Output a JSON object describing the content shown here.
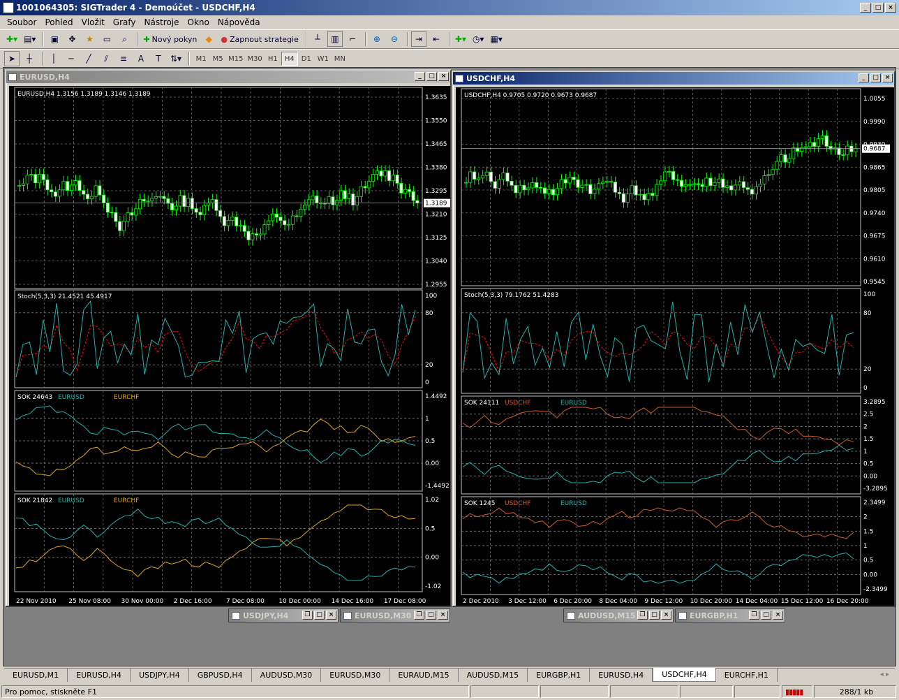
{
  "app": {
    "title": "1001064305: SIGTrader 4 - Demoúčet - USDCHF,H4"
  },
  "menu": [
    "Soubor",
    "Pohled",
    "Vložit",
    "Grafy",
    "Nástroje",
    "Okno",
    "Nápověda"
  ],
  "toolbar1": {
    "new_order": "Nový pokyn",
    "strategy": "Zapnout strategie"
  },
  "timeframes": [
    "M1",
    "M5",
    "M15",
    "M30",
    "H1",
    "H4",
    "D1",
    "W1",
    "MN"
  ],
  "active_timeframe": "H4",
  "eurusd": {
    "title": "EURUSD,H4",
    "ohlc_label": "EURUSD,H4  1.3156 1.3189 1.3146 1.3189",
    "price_ticks": [
      "1.3635",
      "1.3550",
      "1.3465",
      "1.3380",
      "1.3295",
      "1.3210",
      "1.3125",
      "1.3040",
      "1.2955"
    ],
    "current_price": "1.3189",
    "stoch_label": "Stoch(5,3,3) 21.4521 45.4917",
    "stoch_ticks": [
      "100",
      "80",
      "20",
      "0"
    ],
    "sok1": {
      "label": "SOK 24643",
      "leg1": "EURUSD",
      "leg2": "EURCHF",
      "ticks": [
        "1.4492",
        "1",
        "0.5",
        "0.00",
        "-1.4492"
      ]
    },
    "sok2": {
      "label": "SOK 21842",
      "leg1": "EURUSD",
      "leg2": "EURCHF",
      "ticks": [
        "1.02",
        "0.5",
        "0.00",
        "-1.02"
      ]
    },
    "dates": [
      "22 Nov 2010",
      "25 Nov 08:00",
      "30 Nov 00:00",
      "2 Dec 16:00",
      "7 Dec 08:00",
      "10 Dec 00:00",
      "14 Dec 16:00",
      "17 Dec 08:00"
    ]
  },
  "usdchf": {
    "title": "USDCHF,H4",
    "ohlc_label": "USDCHF,H4  0.9705 0.9720 0.9673 0.9687",
    "price_ticks": [
      "1.0055",
      "0.9990",
      "0.9930",
      "0.9865",
      "0.9805",
      "0.9740",
      "0.9675",
      "0.9610",
      "0.9545"
    ],
    "current_price": "0.9687",
    "stoch_label": "Stoch(5,3,3) 79.1762 51.4283",
    "stoch_ticks": [
      "100",
      "80",
      "20",
      "0"
    ],
    "sok1": {
      "label": "SOK 24111",
      "leg1": "USDCHF",
      "leg2": "EURUSD",
      "ticks": [
        "3.2895",
        "2.5",
        "2",
        "1.5",
        "1",
        "0.5",
        "0.00",
        "-3.2895"
      ]
    },
    "sok2": {
      "label": "SOK 1245",
      "leg1": "USDCHF",
      "leg2": "EURUSD",
      "ticks": [
        "2.3499",
        "2",
        "1.5",
        "1",
        "0.5",
        "0.00",
        "-2.3499"
      ]
    },
    "dates": [
      "2 Dec 2010",
      "3 Dec 12:00",
      "6 Dec 20:00",
      "8 Dec 04:00",
      "9 Dec 12:00",
      "10 Dec 20:00",
      "14 Dec 04:00",
      "15 Dec 12:00",
      "16 Dec 20:00"
    ]
  },
  "minimized": [
    "USDJPY,H4",
    "EURUSD,M30",
    "AUDUSD,M15",
    "EURGBP,H1"
  ],
  "tabs": [
    "EURUSD,M1",
    "EURUSD,H4",
    "USDJPY,H4",
    "GBPUSD,H4",
    "AUDUSD,M30",
    "EURUSD,M30",
    "EURAUD,M15",
    "AUDUSD,M15",
    "EURGBP,H1",
    "EURUSD,H4",
    "USDCHF,H4",
    "EURCHF,H1"
  ],
  "active_tab_index": 10,
  "status": {
    "help": "Pro pomoc, stiskněte F1",
    "traffic": "288/1 kb"
  },
  "colors": {
    "bull": "#00ff00",
    "stoch_main": "#20b2aa",
    "stoch_signal": "#ff0000",
    "leg_usd": "#20b2aa",
    "leg_chf": "#daa520",
    "leg_usdchf": "#cd5c2a"
  }
}
